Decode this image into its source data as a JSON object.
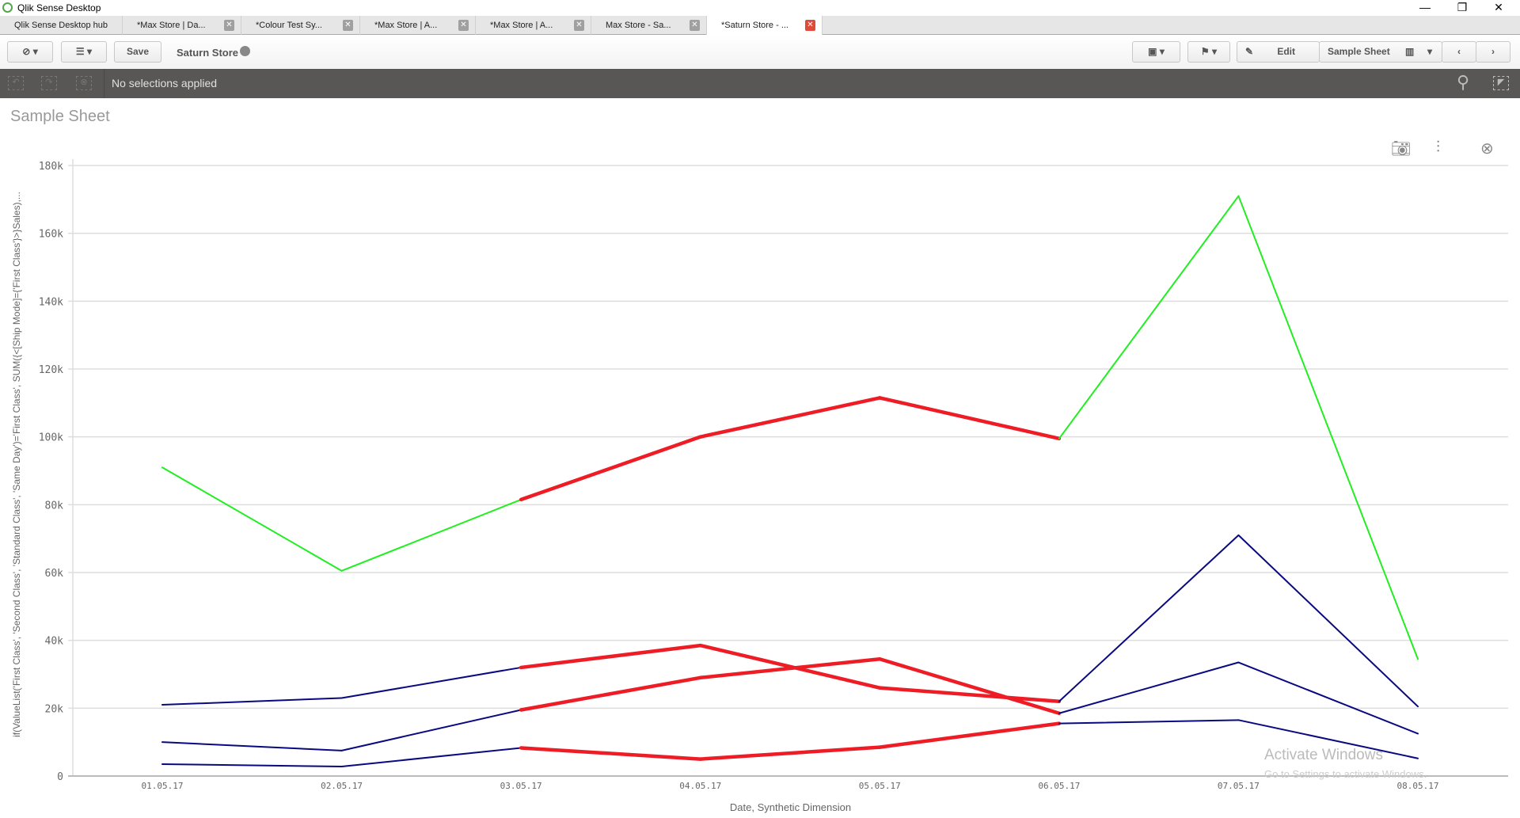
{
  "window": {
    "title": "Qlik Sense Desktop"
  },
  "tabs": [
    {
      "label": "Qlik Sense Desktop hub",
      "closable": false
    },
    {
      "label": "*Max Store | Da...",
      "closable": true
    },
    {
      "label": "*Colour Test Sy...",
      "closable": true
    },
    {
      "label": "*Max Store | A...",
      "closable": true
    },
    {
      "label": "*Max Store | A...",
      "closable": true
    },
    {
      "label": "Max Store - Sa...",
      "closable": true
    },
    {
      "label": "*Saturn Store - ...",
      "closable": true,
      "active": true
    }
  ],
  "toolbar": {
    "save": "Save",
    "app_name": "Saturn Store",
    "edit": "Edit",
    "sheet": "Sample Sheet"
  },
  "selections": {
    "text": "No selections applied"
  },
  "sheet": {
    "title": "Sample Sheet"
  },
  "watermark": {
    "line1": "Activate Windows",
    "line2": "Go to Settings to activate Windows."
  },
  "chart_data": {
    "type": "line",
    "xlabel": "Date, Synthetic Dimension",
    "ylabel": "if(ValueList('First Class', 'Second Class', 'Standard Class', 'Same Day')='First Class', SUM({<[Ship Mode]={'First Class'}>}Sales),...",
    "categories": [
      "01.05.17",
      "02.05.17",
      "03.05.17",
      "04.05.17",
      "05.05.17",
      "06.05.17",
      "07.05.17",
      "08.05.17"
    ],
    "ylim": [
      0,
      180000
    ],
    "yticks": [
      0,
      20000,
      40000,
      60000,
      80000,
      100000,
      120000,
      140000,
      160000,
      180000
    ],
    "ytick_labels": [
      "0",
      "20k",
      "40k",
      "60k",
      "80k",
      "100k",
      "120k",
      "140k",
      "160k",
      "180k"
    ],
    "grid": true,
    "highlight_color": "#ee1c25",
    "highlight_categories": [
      "03.05.17",
      "06.05.17"
    ],
    "series": [
      {
        "color": "#22ee22",
        "values": [
          91000,
          60500,
          81500,
          100000,
          111500,
          99500,
          171000,
          34500
        ]
      },
      {
        "color": "#0a0a80",
        "values": [
          21000,
          23000,
          32000,
          38500,
          26000,
          22000,
          71000,
          20500
        ]
      },
      {
        "color": "#0a0a80",
        "values": [
          10000,
          7500,
          19500,
          29000,
          34500,
          18500,
          33500,
          12500
        ]
      },
      {
        "color": "#0a0a80",
        "values": [
          3500,
          2800,
          8300,
          5000,
          8500,
          15500,
          16500,
          5200
        ]
      }
    ]
  }
}
